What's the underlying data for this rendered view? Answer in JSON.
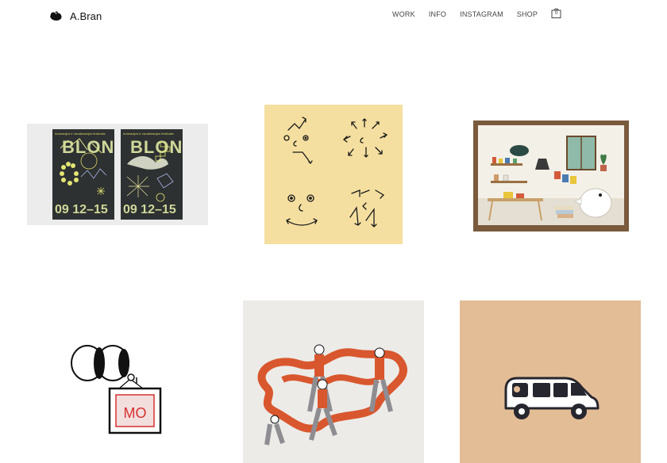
{
  "header": {
    "brand": "A.Bran",
    "nav": [
      "WORK",
      "INFO",
      "INSTAGRAM",
      "SHOP"
    ],
    "cart_count": "0"
  },
  "projects": [
    {
      "name": "BLON festival posters",
      "poster_caption": "Animacijos ir vizualizacijos festivalis",
      "poster_title": "BLON",
      "poster_dates": "09 12–15"
    },
    {
      "name": "Line faces drawing"
    },
    {
      "name": "Miniature room diorama"
    },
    {
      "name": "Eyes and MO frame",
      "frame_text": "MO"
    },
    {
      "name": "Dancing figures illustration"
    },
    {
      "name": "Car illustration"
    }
  ]
}
